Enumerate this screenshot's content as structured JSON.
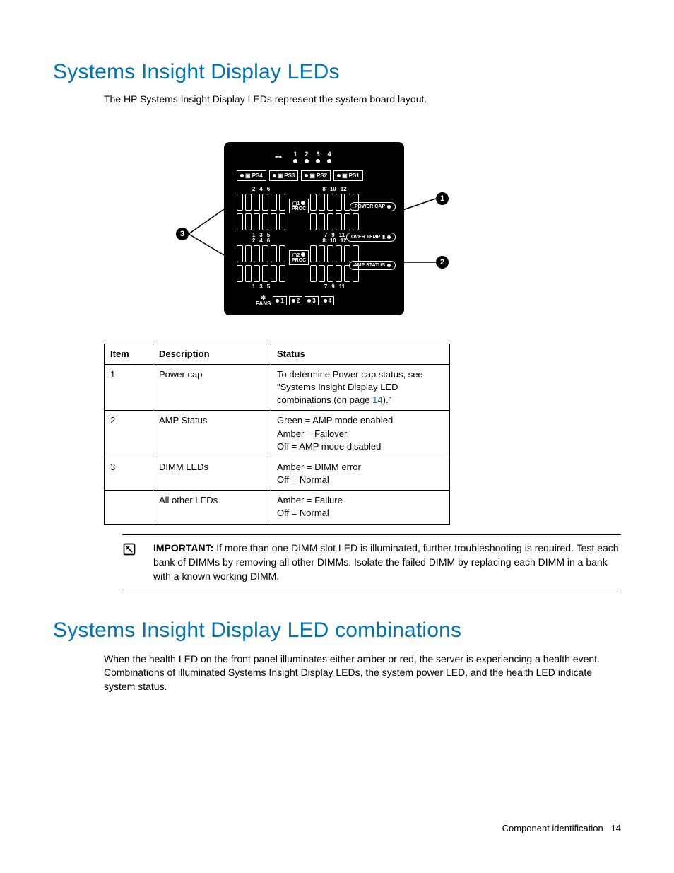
{
  "heading1": "Systems Insight Display LEDs",
  "intro": "The HP Systems Insight Display LEDs represent the system board layout.",
  "diagram": {
    "top_numbers": [
      "1",
      "2",
      "3",
      "4"
    ],
    "ps_boxes": [
      "PS4",
      "PS3",
      "PS2",
      "PS1"
    ],
    "proc1_label": "1",
    "proc1_sub": "PROC",
    "proc2_label": "2",
    "proc2_sub": "PROC",
    "dimm_top_left": [
      "2",
      "4",
      "6"
    ],
    "dimm_bot_left": [
      "1",
      "3",
      "5"
    ],
    "dimm_top_right": [
      "8",
      "10",
      "12"
    ],
    "dimm_bot_right": [
      "7",
      "9",
      "11"
    ],
    "pill_power": "POWER CAP",
    "pill_temp": "OVER TEMP",
    "pill_amp": "AMP STATUS",
    "fans_label": "FANS",
    "fan_boxes": [
      "1",
      "2",
      "3",
      "4"
    ],
    "callout1": "1",
    "callout2": "2",
    "callout3": "3"
  },
  "table": {
    "headers": {
      "item": "Item",
      "desc": "Description",
      "status": "Status"
    },
    "rows": [
      {
        "item": "1",
        "desc": "Power cap",
        "status_prefix": "To determine Power cap status, see \"Systems Insight Display LED combinations (on page ",
        "status_link": "14",
        "status_suffix": ").\""
      },
      {
        "item": "2",
        "desc": "AMP Status",
        "status_lines": [
          "Green = AMP mode enabled",
          "Amber = Failover",
          "Off = AMP mode disabled"
        ]
      },
      {
        "item": "3",
        "desc": "DIMM LEDs",
        "status_lines": [
          "Amber = DIMM error",
          "Off = Normal"
        ]
      },
      {
        "item": "",
        "desc": "All other LEDs",
        "status_lines": [
          "Amber = Failure",
          "Off = Normal"
        ]
      }
    ]
  },
  "important": {
    "label": "IMPORTANT:",
    "text": "If more than one DIMM slot LED is illuminated, further troubleshooting is required. Test each bank of DIMMs by removing all other DIMMs. Isolate the failed DIMM by replacing each DIMM in a bank with a known working DIMM."
  },
  "heading2": "Systems Insight Display LED combinations",
  "para2": "When the health LED on the front panel illuminates either amber or red, the server is experiencing a health event. Combinations of illuminated Systems Insight Display LEDs, the system power LED, and the health LED indicate system status.",
  "footer": {
    "section": "Component identification",
    "page": "14"
  }
}
